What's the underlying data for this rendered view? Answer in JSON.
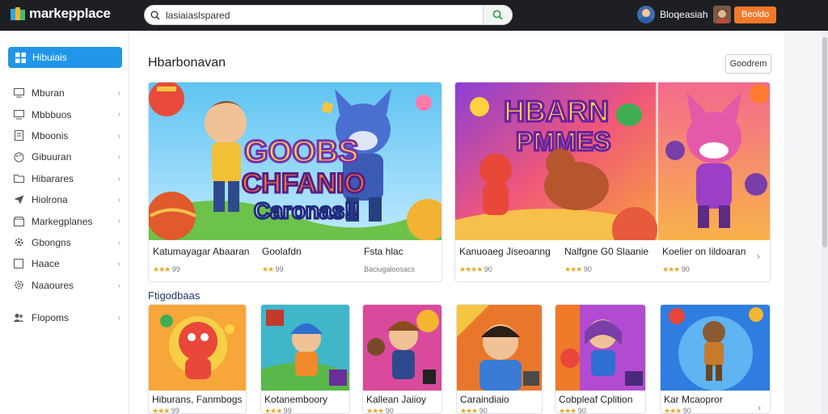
{
  "app": {
    "name": "markepplace"
  },
  "search": {
    "placeholder": "",
    "value": "lasiaiaslspared"
  },
  "header": {
    "user_name": "Bloqeasiah",
    "cta_label": "Beoldo"
  },
  "sidebar": {
    "active": {
      "label": "Hibuiais",
      "icon": "grid-icon"
    },
    "items": [
      {
        "label": "Mburan",
        "icon": "monitor-icon"
      },
      {
        "label": "Mbbbuos",
        "icon": "monitor-icon"
      },
      {
        "label": "Mboonis",
        "icon": "document-icon"
      },
      {
        "label": "Gibuuran",
        "icon": "palette-icon"
      },
      {
        "label": "Hibarares",
        "icon": "folder-icon"
      },
      {
        "label": "Hiolrona",
        "icon": "send-icon"
      },
      {
        "label": "Markegplanes",
        "icon": "store-icon"
      },
      {
        "label": "Gbongns",
        "icon": "cog-icon"
      },
      {
        "label": "Haace",
        "icon": "square-icon"
      },
      {
        "label": "Naaoures",
        "icon": "gear-icon"
      }
    ],
    "footer_item": {
      "label": "Flopoms",
      "icon": "users-icon"
    }
  },
  "featured": {
    "title": "Hbarbonavan",
    "see_all": "Goodrem",
    "cards": [
      {
        "banner_line1": "GOOBS",
        "banner_line2": "CHFANIO",
        "banner_line3": "Caronas!!",
        "cols": [
          {
            "title": "Katumayagar Abaaran",
            "rating_stars": "★★★",
            "rating_text": "99"
          },
          {
            "title": "Goolafdn",
            "rating_stars": "★★",
            "rating_text": "99"
          },
          {
            "title": "Fsta hlac",
            "rating_stars": "",
            "rating_text": "Baciugaloosacs"
          }
        ]
      },
      {
        "banner_line1": "HBARN",
        "banner_line2": "PMMES",
        "cols": [
          {
            "title": "Kanuoaeg Jiseoanng",
            "rating_stars": "★★★★",
            "rating_text": "90"
          },
          {
            "title": "Nalfgne G0 Slaanie",
            "rating_stars": "★★★",
            "rating_text": "90"
          },
          {
            "title": "Koelier on Iildoaran",
            "rating_stars": "★★★",
            "rating_text": "90"
          }
        ]
      }
    ]
  },
  "popular": {
    "title": "Ftigodbaas",
    "cards": [
      {
        "title": "Hiburans, Fanmbogs",
        "rating_stars": "★★★",
        "rating_text": "99"
      },
      {
        "title": "Kotanemboory",
        "rating_stars": "★★★",
        "rating_text": "99"
      },
      {
        "title": "Kallean Jaiioy",
        "rating_stars": "★★★",
        "rating_text": "90"
      },
      {
        "title": "Caraindiaio",
        "rating_stars": "★★★",
        "rating_text": "90"
      },
      {
        "title": "Cobpleaf Cplition",
        "rating_stars": "★★★",
        "rating_text": "90"
      },
      {
        "title": "Kar Mcaopror",
        "rating_stars": "★★★",
        "rating_text": "90"
      }
    ]
  },
  "colors": {
    "topbar": "#1d1f23",
    "accent_blue": "#2196e8",
    "cta_orange": "#f07a2a",
    "star": "#e5a823"
  }
}
